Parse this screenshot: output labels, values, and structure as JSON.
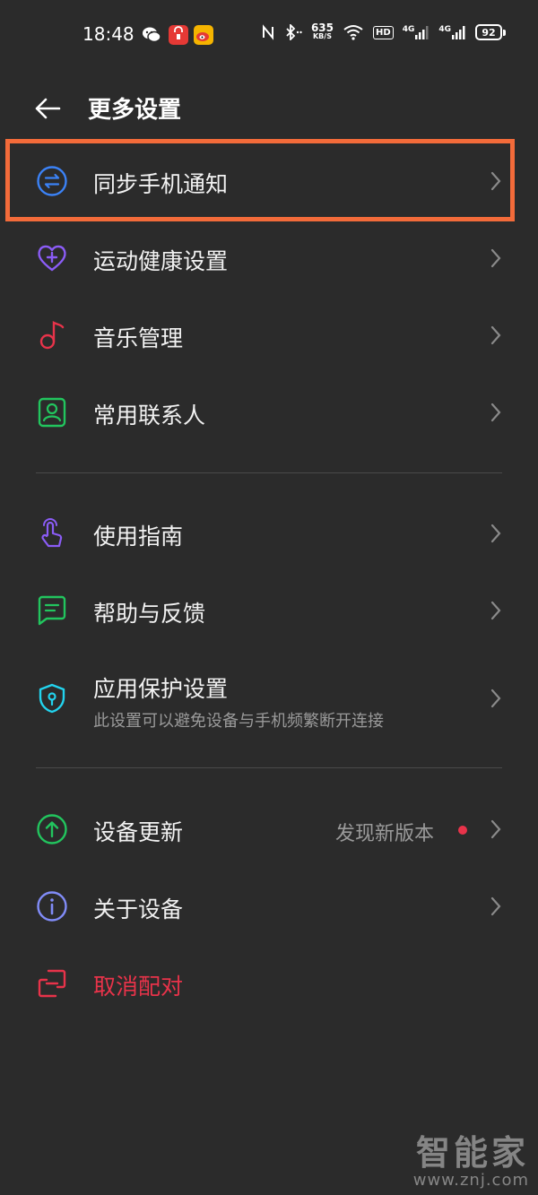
{
  "status_bar": {
    "time": "18:48",
    "net_speed_value": "635",
    "net_speed_unit": "KB/S",
    "hd_label": "HD",
    "signal1_label": "4G",
    "signal2_label": "4G",
    "battery_level": "92"
  },
  "header": {
    "title": "更多设置"
  },
  "menu": {
    "sync_notifications": {
      "label": "同步手机通知",
      "icon": "sync-arrows-icon",
      "color": "#3b82f6"
    },
    "health_settings": {
      "label": "运动健康设置",
      "icon": "heart-plus-icon",
      "color": "#8b5cf6"
    },
    "music_management": {
      "label": "音乐管理",
      "icon": "music-note-icon",
      "color": "#e8334a"
    },
    "frequent_contacts": {
      "label": "常用联系人",
      "icon": "contact-card-icon",
      "color": "#22c55e"
    },
    "user_guide": {
      "label": "使用指南",
      "icon": "hand-tap-icon",
      "color": "#8b5cf6"
    },
    "help_feedback": {
      "label": "帮助与反馈",
      "icon": "chat-bubble-icon",
      "color": "#22c55e"
    },
    "app_protection": {
      "label": "应用保护设置",
      "subtitle": "此设置可以避免设备与手机频繁断开连接",
      "icon": "shield-icon",
      "color": "#22d3ee"
    },
    "device_update": {
      "label": "设备更新",
      "value": "发现新版本",
      "icon": "upload-arrow-icon",
      "color": "#22c55e"
    },
    "about_device": {
      "label": "关于设备",
      "icon": "info-icon",
      "color": "#818cf8"
    },
    "unpair": {
      "label": "取消配对",
      "icon": "unpair-icon",
      "color": "#e8334a"
    }
  },
  "watermark": {
    "brand": "智能家",
    "url": "www.znj.com"
  },
  "colors": {
    "background": "#2b2b2b",
    "highlight": "#f36b3a",
    "danger": "#e8334a"
  }
}
